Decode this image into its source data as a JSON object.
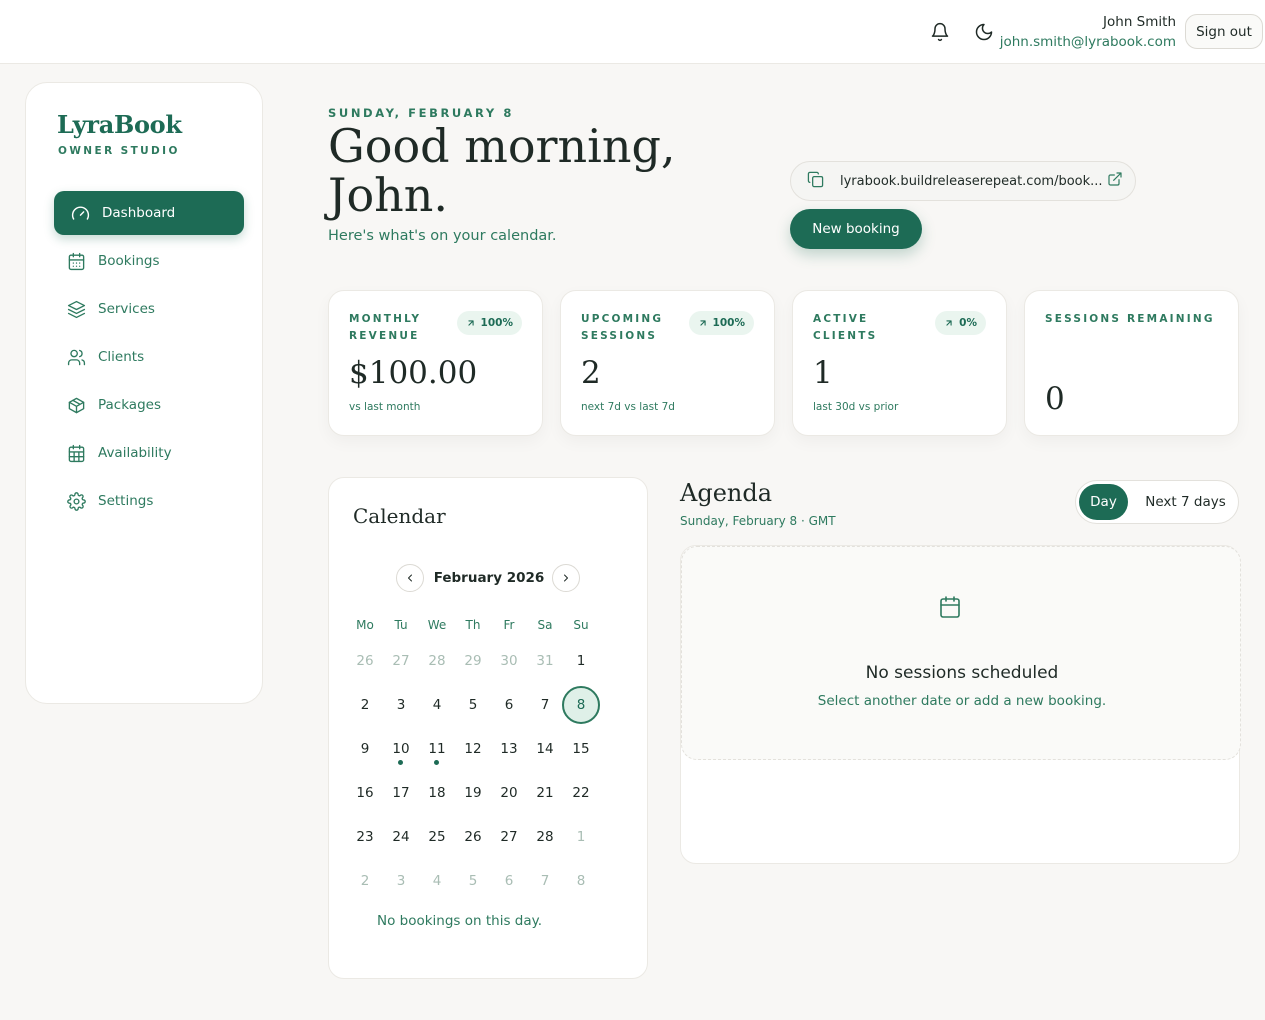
{
  "topbar": {
    "user_name": "John Smith",
    "user_email": "john.smith@lyrabook.com",
    "sign_out_label": "Sign out",
    "icons": [
      "bell-icon",
      "moon-icon"
    ]
  },
  "sidebar": {
    "brand": "LyraBook",
    "brand_sub": "OWNER STUDIO",
    "items": [
      {
        "label": "Dashboard",
        "icon": "gauge-icon",
        "active": true
      },
      {
        "label": "Bookings",
        "icon": "calendar-icon"
      },
      {
        "label": "Services",
        "icon": "layers-icon"
      },
      {
        "label": "Clients",
        "icon": "users-icon"
      },
      {
        "label": "Packages",
        "icon": "package-icon"
      },
      {
        "label": "Availability",
        "icon": "calendar-grid-icon"
      },
      {
        "label": "Settings",
        "icon": "gear-icon"
      }
    ]
  },
  "header": {
    "date_line": "SUNDAY, FEBRUARY 8",
    "greeting": "Good morning, John.",
    "subtitle": "Here's what's on your calendar.",
    "booking_url": "lyrabook.buildreleaserepeat.com/book...",
    "new_booking_label": "New booking"
  },
  "stats": [
    {
      "label": "MONTHLY REVENUE",
      "badge": "100%",
      "value": "$100.00",
      "note": "vs last month"
    },
    {
      "label": "UPCOMING SESSIONS",
      "badge": "100%",
      "value": "2",
      "note": "next 7d vs last 7d"
    },
    {
      "label": "ACTIVE CLIENTS",
      "badge": "0%",
      "value": "1",
      "note": "last 30d vs prior"
    },
    {
      "label": "SESSIONS REMAINING",
      "value": "0"
    }
  ],
  "calendar": {
    "title": "Calendar",
    "month": "February 2026",
    "weekdays": [
      "Mo",
      "Tu",
      "We",
      "Th",
      "Fr",
      "Sa",
      "Su"
    ],
    "weeks": [
      [
        {
          "d": "26",
          "m": true
        },
        {
          "d": "27",
          "m": true
        },
        {
          "d": "28",
          "m": true
        },
        {
          "d": "29",
          "m": true
        },
        {
          "d": "30",
          "m": true
        },
        {
          "d": "31",
          "m": true
        },
        {
          "d": "1"
        }
      ],
      [
        {
          "d": "2"
        },
        {
          "d": "3"
        },
        {
          "d": "4"
        },
        {
          "d": "5"
        },
        {
          "d": "6"
        },
        {
          "d": "7"
        },
        {
          "d": "8",
          "sel": true
        }
      ],
      [
        {
          "d": "9"
        },
        {
          "d": "10",
          "dot": true
        },
        {
          "d": "11",
          "dot": true
        },
        {
          "d": "12"
        },
        {
          "d": "13"
        },
        {
          "d": "14"
        },
        {
          "d": "15"
        }
      ],
      [
        {
          "d": "16"
        },
        {
          "d": "17"
        },
        {
          "d": "18"
        },
        {
          "d": "19"
        },
        {
          "d": "20"
        },
        {
          "d": "21"
        },
        {
          "d": "22"
        }
      ],
      [
        {
          "d": "23"
        },
        {
          "d": "24"
        },
        {
          "d": "25"
        },
        {
          "d": "26"
        },
        {
          "d": "27"
        },
        {
          "d": "28"
        },
        {
          "d": "1",
          "m": true
        }
      ],
      [
        {
          "d": "2",
          "m": true
        },
        {
          "d": "3",
          "m": true
        },
        {
          "d": "4",
          "m": true
        },
        {
          "d": "5",
          "m": true
        },
        {
          "d": "6",
          "m": true
        },
        {
          "d": "7",
          "m": true
        },
        {
          "d": "8",
          "m": true
        }
      ]
    ],
    "empty_text": "No bookings on this day."
  },
  "agenda": {
    "title": "Agenda",
    "subtitle": "Sunday, February 8 · GMT",
    "toggle_day": "Day",
    "toggle_week": "Next 7 days",
    "empty_title": "No sessions scheduled",
    "empty_sub": "Select another date or add a new booking."
  },
  "colors": {
    "accent": "#1d6b55",
    "accent_text": "#2e7a5f",
    "badge_bg": "#eaf5ef",
    "background": "#f8f7f5"
  }
}
